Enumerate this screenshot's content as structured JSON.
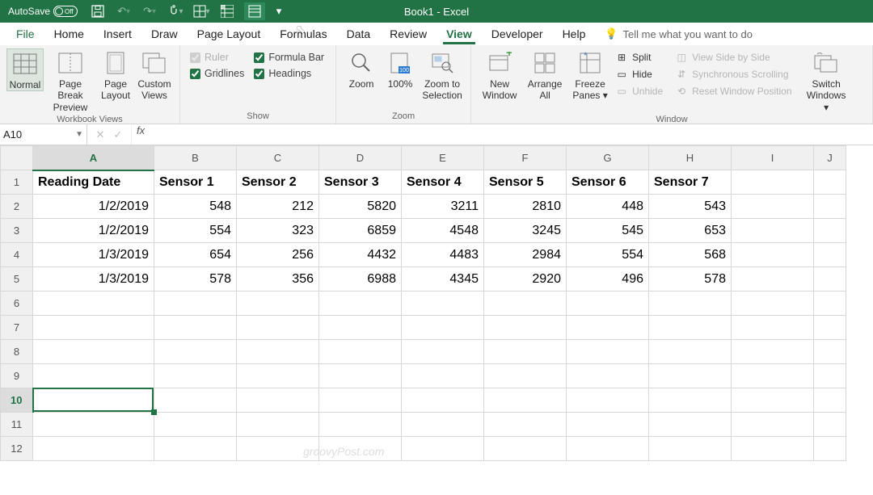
{
  "titlebar": {
    "autosave_label": "AutoSave",
    "autosave_state": "Off",
    "title": "Book1 - Excel"
  },
  "menu": {
    "file": "File",
    "tabs": [
      "Home",
      "Insert",
      "Draw",
      "Page Layout",
      "Formulas",
      "Data",
      "Review",
      "View",
      "Developer",
      "Help"
    ],
    "active": "View",
    "tellme": "Tell me what you want to do"
  },
  "ribbon": {
    "groups": {
      "workbook_views": {
        "label": "Workbook Views",
        "normal": "Normal",
        "page_break": "Page Break Preview",
        "page_layout": "Page Layout",
        "custom_views": "Custom Views"
      },
      "show": {
        "label": "Show",
        "ruler": "Ruler",
        "gridlines": "Gridlines",
        "formula_bar": "Formula Bar",
        "headings": "Headings"
      },
      "zoom": {
        "label": "Zoom",
        "zoom": "Zoom",
        "p100": "100%",
        "to_sel": "Zoom to Selection"
      },
      "window": {
        "label": "Window",
        "new_window": "New Window",
        "arrange_all": "Arrange All",
        "freeze": "Freeze Panes",
        "split": "Split",
        "hide": "Hide",
        "unhide": "Unhide",
        "side": "View Side by Side",
        "sync": "Synchronous Scrolling",
        "reset": "Reset Window Position",
        "switch": "Switch Windows"
      }
    }
  },
  "formula_bar": {
    "namebox": "A10",
    "fx": "fx",
    "value": ""
  },
  "grid": {
    "columns": [
      "A",
      "B",
      "C",
      "D",
      "E",
      "F",
      "G",
      "H",
      "I",
      "J"
    ],
    "row_count": 12,
    "selected_cell": "A10",
    "headers": [
      "Reading Date",
      "Sensor 1",
      "Sensor 2",
      "Sensor 3",
      "Sensor 4",
      "Sensor 5",
      "Sensor 6",
      "Sensor 7"
    ],
    "rows": [
      [
        "1/2/2019",
        548,
        212,
        5820,
        3211,
        2810,
        448,
        543
      ],
      [
        "1/2/2019",
        554,
        323,
        6859,
        4548,
        3245,
        545,
        653
      ],
      [
        "1/3/2019",
        654,
        256,
        4432,
        4483,
        2984,
        554,
        568
      ],
      [
        "1/3/2019",
        578,
        356,
        6988,
        4345,
        2920,
        496,
        578
      ]
    ]
  },
  "watermark": "groovyPost.com"
}
